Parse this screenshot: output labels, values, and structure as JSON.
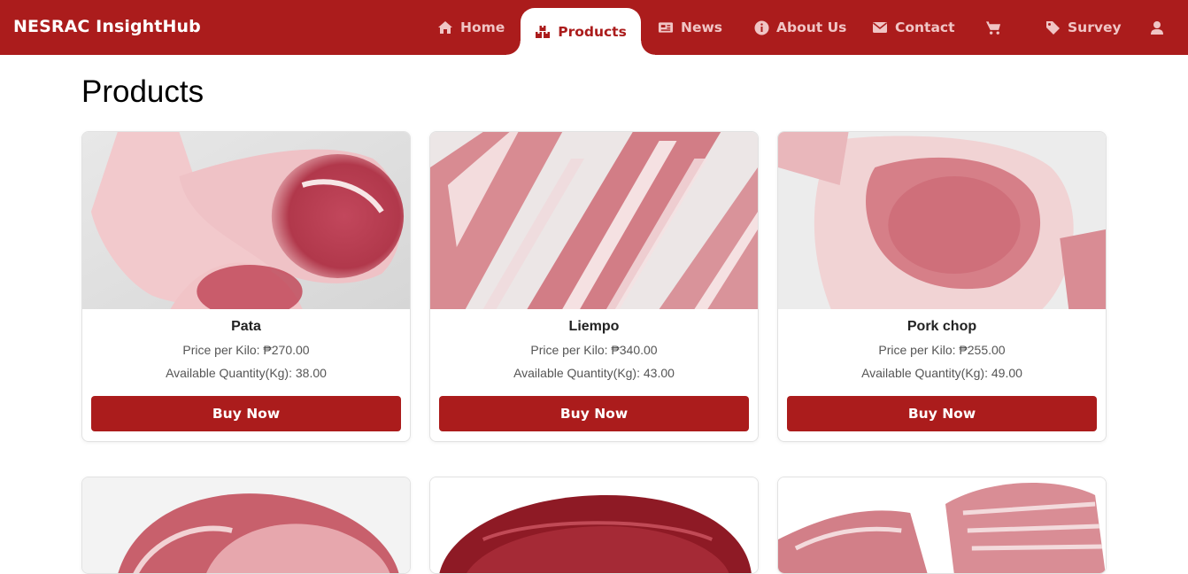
{
  "brand": "NESRAC InsightHub",
  "nav": [
    {
      "label": "Home",
      "icon": "home-icon"
    },
    {
      "label": "Products",
      "icon": "products-icon",
      "active": true
    },
    {
      "label": "News",
      "icon": "newspaper-icon"
    },
    {
      "label": "About Us",
      "icon": "info-icon"
    },
    {
      "label": "Contact",
      "icon": "envelope-icon"
    },
    {
      "label": "",
      "icon": "cart-icon"
    },
    {
      "label": "Survey",
      "icon": "tag-icon"
    },
    {
      "label": "",
      "icon": "user-icon"
    }
  ],
  "page_title": "Products",
  "products": [
    {
      "name": "Pata",
      "price": "Price per Kilo: ₱270.00",
      "qty": "Available Quantity(Kg): 38.00",
      "button": "Buy Now"
    },
    {
      "name": "Liempo",
      "price": "Price per Kilo: ₱340.00",
      "qty": "Available Quantity(Kg): 43.00",
      "button": "Buy Now"
    },
    {
      "name": "Pork chop",
      "price": "Price per Kilo: ₱255.00",
      "qty": "Available Quantity(Kg): 49.00",
      "button": "Buy Now"
    }
  ],
  "colors": {
    "brand": "#ab1c1c",
    "nav_text": "#f0c5c5",
    "active_bg": "#ffffff"
  }
}
